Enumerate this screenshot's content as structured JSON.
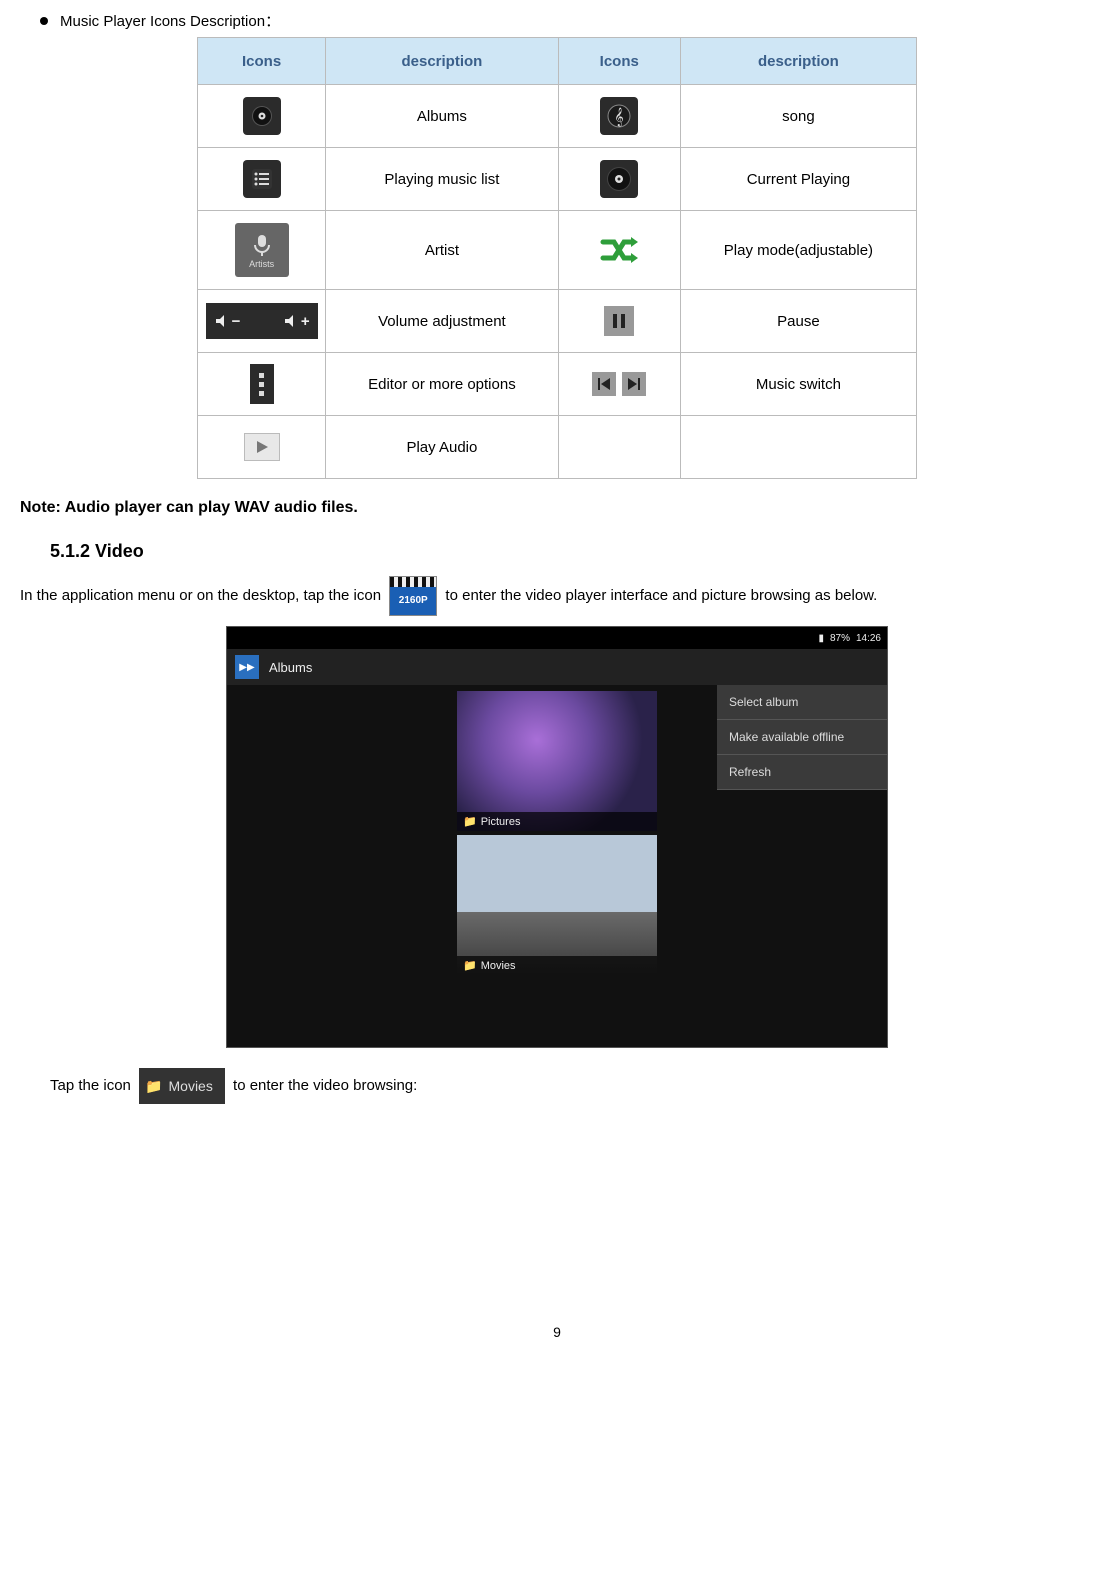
{
  "bullet_title": "Music Player Icons Description：",
  "table": {
    "headers": [
      "Icons",
      "description",
      "Icons",
      "description"
    ],
    "rows": [
      {
        "d1": "Albums",
        "d2": "song"
      },
      {
        "d1": "Playing music list",
        "d2": "Current Playing"
      },
      {
        "d1": "Artist",
        "d2": "Play mode(adjustable)"
      },
      {
        "d1": "Volume adjustment",
        "d2": "Pause"
      },
      {
        "d1": "Editor or more options",
        "d2": "Music switch"
      },
      {
        "d1": "Play Audio",
        "d2": ""
      }
    ]
  },
  "note": "Note: Audio player can play WAV audio files.",
  "heading": "5.1.2 Video",
  "para1_a": "In the application menu or on the desktop, tap the icon",
  "para1_b": "to enter the video player interface and picture browsing as below.",
  "screenshot": {
    "status_battery": "87%",
    "status_time": "14:26",
    "header_label": "Albums",
    "thumb1": "Pictures",
    "thumb2": "Movies",
    "menu": [
      "Select album",
      "Make available offline",
      "Refresh"
    ]
  },
  "para2_a": "Tap the icon",
  "para2_b": "to enter the video browsing:",
  "movies_chip": "Movies",
  "video_badge": "2160P",
  "page_number": "9"
}
